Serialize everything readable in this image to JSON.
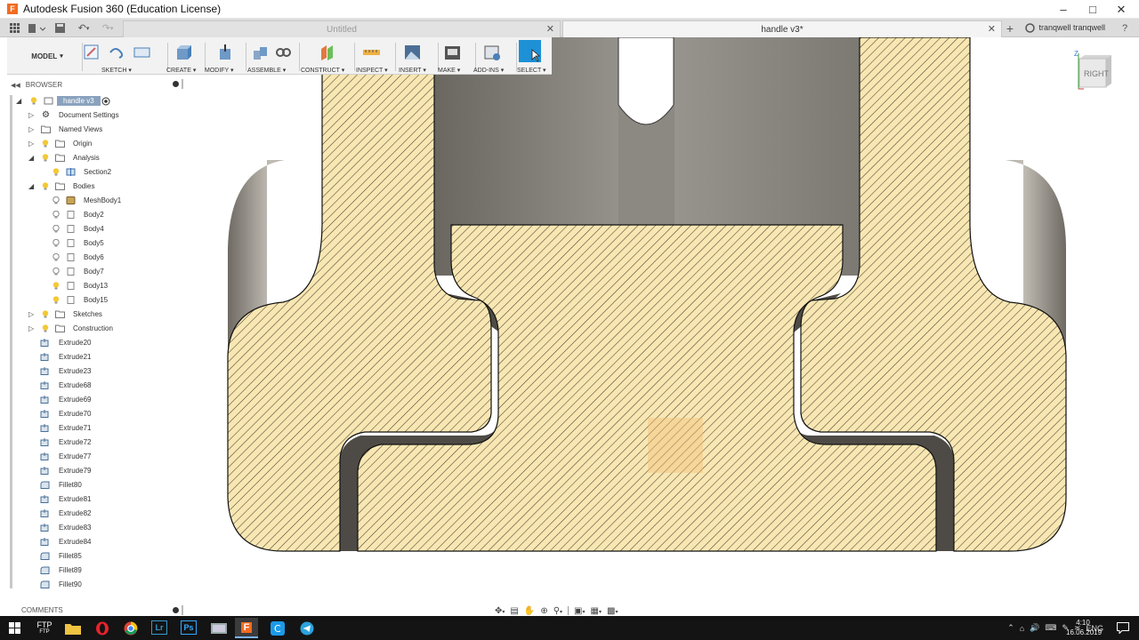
{
  "window": {
    "title": "Autodesk Fusion 360 (Education License)",
    "app_letter": "F"
  },
  "tabs": {
    "inactive_label": "Untitled",
    "active_label": "handle v3*",
    "user": "tranqwell tranqwell",
    "close_glyph": "✕",
    "add_glyph": "+"
  },
  "toolbar": {
    "workspace": "MODEL",
    "groups": [
      {
        "label": "SKETCH",
        "icon": "sketch-icon"
      },
      {
        "label": "CREATE",
        "icon": "create-icon"
      },
      {
        "label": "MODIFY",
        "icon": "modify-icon"
      },
      {
        "label": "ASSEMBLE",
        "icon": "assemble-icon"
      },
      {
        "label": "CONSTRUCT",
        "icon": "construct-icon"
      },
      {
        "label": "INSPECT",
        "icon": "inspect-icon"
      },
      {
        "label": "INSERT",
        "icon": "insert-icon"
      },
      {
        "label": "MAKE",
        "icon": "make-icon"
      },
      {
        "label": "ADD-INS",
        "icon": "add-ins-icon"
      },
      {
        "label": "SELECT",
        "icon": "select-icon"
      }
    ]
  },
  "browser": {
    "header": "BROWSER",
    "root": "handle v3",
    "items": [
      {
        "label": "Document Settings"
      },
      {
        "label": "Named Views"
      },
      {
        "label": "Origin"
      },
      {
        "label": "Analysis"
      },
      {
        "label": "Section2"
      },
      {
        "label": "Bodies"
      },
      {
        "label": "MeshBody1"
      },
      {
        "label": "Body2"
      },
      {
        "label": "Body4"
      },
      {
        "label": "Body5"
      },
      {
        "label": "Body6"
      },
      {
        "label": "Body7"
      },
      {
        "label": "Body13"
      },
      {
        "label": "Body15"
      },
      {
        "label": "Sketches"
      },
      {
        "label": "Construction"
      }
    ],
    "features": [
      "Extrude20",
      "Extrude21",
      "Extrude23",
      "Extrude68",
      "Extrude69",
      "Extrude70",
      "Extrude71",
      "Extrude72",
      "Extrude77",
      "Extrude79",
      "Fillet80",
      "Extrude81",
      "Extrude82",
      "Extrude83",
      "Extrude84",
      "Fillet85",
      "Fillet89",
      "Fillet90"
    ]
  },
  "comments": {
    "label": "COMMENTS"
  },
  "viewcube": {
    "face": "RIGHT",
    "axis_z": "Z"
  },
  "taskbar": {
    "ftp_label": "FTP",
    "ftp_sub": "FTP",
    "lang": "ENG",
    "time": "4:10",
    "date": "16.06.2019"
  },
  "colors": {
    "section_fill": "#f8e7b2",
    "hatch": "#4a4236",
    "select_active": "#1e90d6",
    "taskbar": "#141414"
  }
}
